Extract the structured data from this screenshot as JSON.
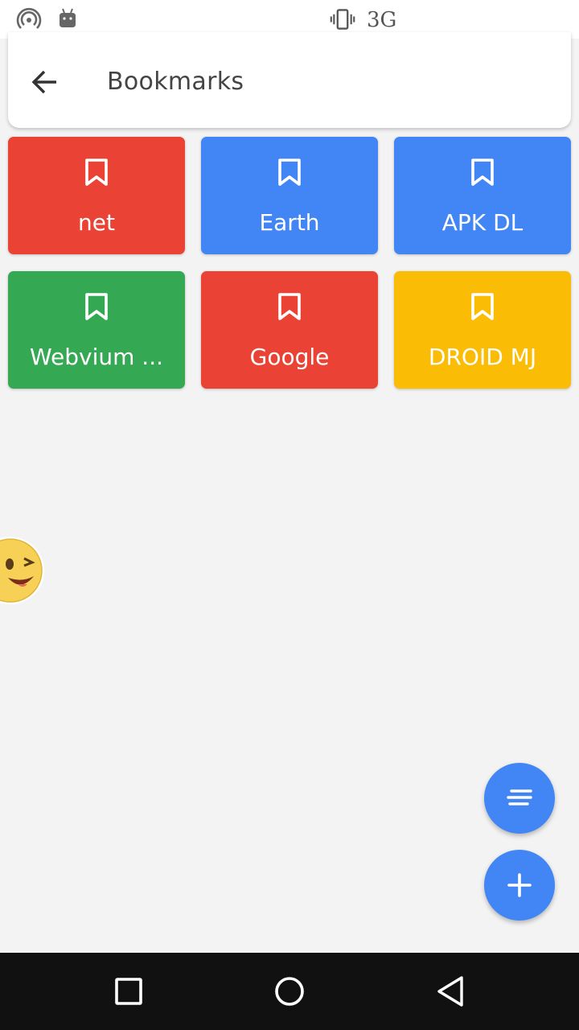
{
  "status_bar": {
    "icons": [
      "hotspot-icon",
      "android-icon",
      "vibrate-icon"
    ],
    "network": "3G"
  },
  "app_bar": {
    "title": "Bookmarks",
    "back_icon": "arrow-back-icon"
  },
  "bookmarks": [
    {
      "label": "net",
      "color": "#ea4335"
    },
    {
      "label": "Earth",
      "color": "#4285f4"
    },
    {
      "label": "APK DL",
      "color": "#4285f4"
    },
    {
      "label": "Webvium ...",
      "color": "#34a853"
    },
    {
      "label": "Google",
      "color": "#ea4335"
    },
    {
      "label": "DROID MJ",
      "color": "#fbbc05"
    }
  ],
  "fabs": [
    {
      "icon": "sort-icon",
      "color": "#4285f4"
    },
    {
      "icon": "add-icon",
      "color": "#4285f4"
    }
  ],
  "nav_bar": {
    "icons": [
      "recents-icon",
      "home-icon",
      "back-icon"
    ]
  }
}
